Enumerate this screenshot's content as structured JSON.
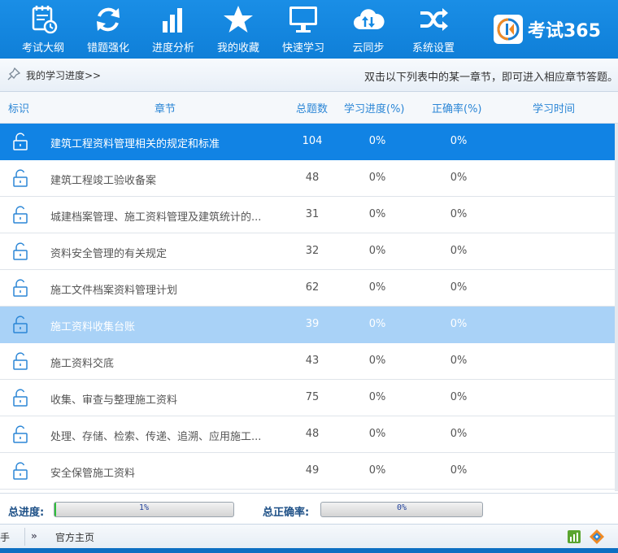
{
  "toolbar": {
    "items": [
      {
        "label": "考试大纲",
        "icon": "calendar-icon"
      },
      {
        "label": "错题强化",
        "icon": "refresh-icon"
      },
      {
        "label": "进度分析",
        "icon": "bar-chart-icon"
      },
      {
        "label": "我的收藏",
        "icon": "star-icon"
      },
      {
        "label": "快速学习",
        "icon": "monitor-icon"
      },
      {
        "label": "云同步",
        "icon": "cloud-sync-icon"
      },
      {
        "label": "系统设置",
        "icon": "shuffle-icon"
      }
    ],
    "brand": "考试365"
  },
  "infobar": {
    "progress_link": "我的学习进度>>",
    "hint": "双击以下列表中的某一章节，即可进入相应章节答题。"
  },
  "table": {
    "headers": [
      "标识",
      "章节",
      "总题数",
      "学习进度(%)",
      "正确率(%)",
      "学习时间"
    ],
    "rows": [
      {
        "title": "建筑工程资料管理相关的规定和标准",
        "total": "104",
        "progress": "0%",
        "accuracy": "0%",
        "time": ""
      },
      {
        "title": "建筑工程竣工验收备案",
        "total": "48",
        "progress": "0%",
        "accuracy": "0%",
        "time": ""
      },
      {
        "title": "城建档案管理、施工资料管理及建筑统计的...",
        "total": "31",
        "progress": "0%",
        "accuracy": "0%",
        "time": ""
      },
      {
        "title": "资料安全管理的有关规定",
        "total": "32",
        "progress": "0%",
        "accuracy": "0%",
        "time": ""
      },
      {
        "title": "施工文件档案资料管理计划",
        "total": "62",
        "progress": "0%",
        "accuracy": "0%",
        "time": ""
      },
      {
        "title": "施工资料收集台账",
        "total": "39",
        "progress": "0%",
        "accuracy": "0%",
        "time": ""
      },
      {
        "title": "施工资料交底",
        "total": "43",
        "progress": "0%",
        "accuracy": "0%",
        "time": ""
      },
      {
        "title": "收集、审查与整理施工资料",
        "total": "75",
        "progress": "0%",
        "accuracy": "0%",
        "time": ""
      },
      {
        "title": "处理、存储、检索、传递、追溯、应用施工...",
        "total": "48",
        "progress": "0%",
        "accuracy": "0%",
        "time": ""
      },
      {
        "title": "安全保管施工资料",
        "total": "49",
        "progress": "0%",
        "accuracy": "0%",
        "time": ""
      }
    ]
  },
  "totals": {
    "progress_label": "总进度:",
    "progress_text": "1%",
    "progress_value": 0.01,
    "accuracy_label": "总正确率:",
    "accuracy_text": "0%",
    "accuracy_value": 0
  },
  "statusbar": {
    "left_fragment": "手",
    "home_link": "官方主页"
  },
  "colors": {
    "toolbar_blue": "#1589e3",
    "selected_row": "#1183e4",
    "hover_row": "#a9d2f7",
    "header_text": "#2b86d6"
  }
}
